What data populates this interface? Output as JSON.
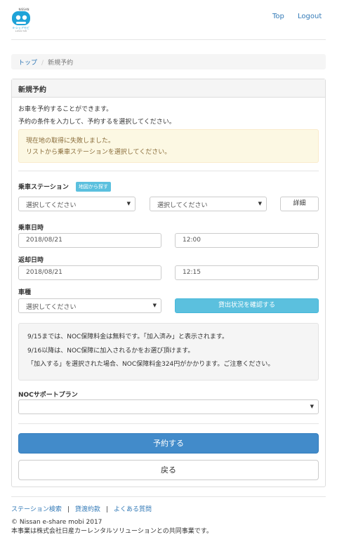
{
  "header": {
    "logo_text": "NISSAN e-シェアモビ",
    "nav": {
      "top": "Top",
      "logout": "Logout"
    }
  },
  "breadcrumb": {
    "home": "トップ",
    "separator": "/",
    "current": "新規予約"
  },
  "panel": {
    "title": "新規予約",
    "intro1": "お車を予約することができます。",
    "intro2": "予約の条件を入力して、予約するを選択してください。",
    "alert_line1": "現在地の取得に失敗しました。",
    "alert_line2": "リストから乗車ステーションを選択してください。",
    "station": {
      "label": "乗車ステーション",
      "map_button": "地図から探す",
      "select1": "選択してください",
      "select2": "選択してください",
      "detail_button": "詳細"
    },
    "pickup": {
      "label": "乗車日時",
      "date": "2018/08/21",
      "time": "12:00"
    },
    "return": {
      "label": "返却日時",
      "date": "2018/08/21",
      "time": "12:15"
    },
    "car_type": {
      "label": "車種",
      "select": "選択してください",
      "check_button": "貸出状況を確認する"
    },
    "notice": [
      "9/15までは、NOC保障料金は無料です。「加入済み」と表示されます。",
      "9/16以降は、NOC保障に加入されるかをお選び頂けます。",
      "「加入する」を選択された場合、NOC保障料金324円がかかります。ご注意ください。"
    ],
    "noc": {
      "label": "NOCサポートプラン",
      "select": ""
    },
    "reserve_button": "予約する",
    "back_button": "戻る"
  },
  "footer": {
    "links": [
      "ステーション検索",
      "貸渡約款",
      "よくある質問"
    ],
    "separator": "|",
    "copyright": "© Nissan e-share mobi 2017",
    "note": "本事業は株式会社日産カーレンタルソリューションとの共同事業です。"
  },
  "colors": {
    "link": "#337ab7",
    "primary": "#428bca",
    "info": "#5bc0de",
    "warning_bg": "#fcf8e3",
    "logo_blue": "#1fa3d8"
  }
}
